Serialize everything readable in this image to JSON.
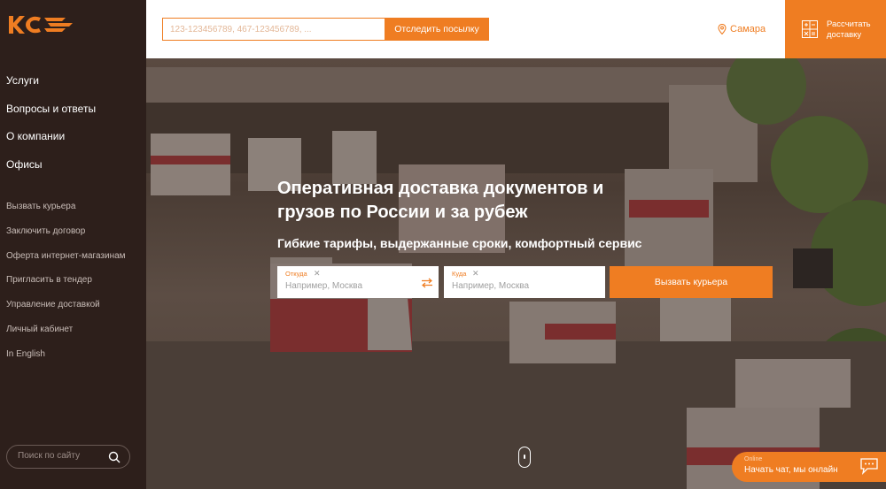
{
  "brand": {
    "accent": "#ef7d22",
    "sidebar_bg": "#2d1f1b"
  },
  "sidebar": {
    "logo_icon": "kce-logo",
    "main_nav": [
      {
        "label": "Услуги"
      },
      {
        "label": "Вопросы и ответы"
      },
      {
        "label": "О компании"
      },
      {
        "label": "Офисы"
      }
    ],
    "sub_nav": [
      {
        "label": "Вызвать курьера"
      },
      {
        "label": "Заключить договор"
      },
      {
        "label": "Оферта интернет-магазинам"
      },
      {
        "label": "Пригласить в тендер"
      },
      {
        "label": "Управление доставкой"
      },
      {
        "label": "Личный кабинет"
      },
      {
        "label": "In English"
      }
    ],
    "search": {
      "placeholder": "Поиск по сайту",
      "icon": "search-icon"
    }
  },
  "topbar": {
    "tracking": {
      "placeholder": "123-123456789, 467-123456789, ...",
      "button_label": "Отследить посылку"
    },
    "city": {
      "label": "Самара",
      "icon": "location-pin-icon"
    },
    "calculator": {
      "label": "Рассчитать доставку",
      "icon": "calculator-icon"
    }
  },
  "hero": {
    "title": "Оперативная доставка документов и грузов по России и за рубеж",
    "subtitle": "Гибкие тарифы, выдержанные сроки, комфортный сервис",
    "from": {
      "label": "Откуда",
      "placeholder": "Например, Москва"
    },
    "to": {
      "label": "Куда",
      "placeholder": "Например, Москва"
    },
    "courier_button": "Вызвать курьера"
  },
  "chat": {
    "status": "Online",
    "label": "Начать чат, мы онлайн",
    "icon": "chat-bubble-icon"
  }
}
